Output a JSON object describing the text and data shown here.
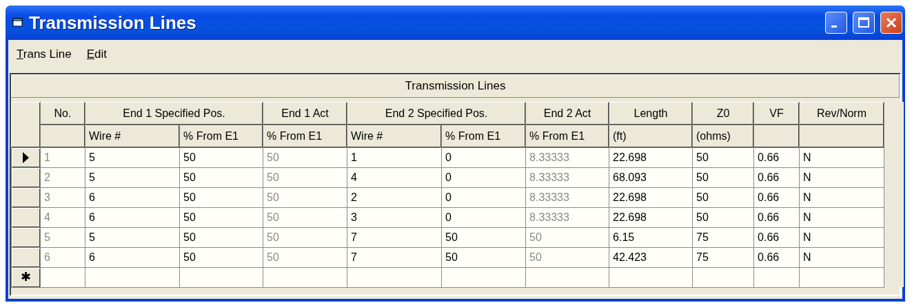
{
  "window": {
    "title": "Transmission Lines"
  },
  "menu": [
    "Trans Line",
    "Edit"
  ],
  "grid": {
    "caption": "Transmission Lines",
    "header_groups": [
      {
        "label": "No.",
        "columns": [
          {
            "readonly": true
          }
        ]
      },
      {
        "label": "End 1 Specified Pos.",
        "columns": [
          {
            "subheader": "Wire #",
            "readonly": false
          },
          {
            "subheader": "% From E1",
            "readonly": false
          }
        ]
      },
      {
        "label": "End 1 Act",
        "columns": [
          {
            "subheader": "% From E1",
            "readonly": true
          }
        ]
      },
      {
        "label": "End 2 Specified Pos.",
        "columns": [
          {
            "subheader": "Wire #",
            "readonly": false
          },
          {
            "subheader": "% From E1",
            "readonly": false
          }
        ]
      },
      {
        "label": "End 2 Act",
        "columns": [
          {
            "subheader": "% From E1",
            "readonly": true
          }
        ]
      },
      {
        "label": "Length",
        "columns": [
          {
            "subheader": "(ft)",
            "readonly": false
          }
        ]
      },
      {
        "label": "Z0",
        "columns": [
          {
            "subheader": "(ohms)",
            "readonly": false
          }
        ]
      },
      {
        "label": "VF",
        "columns": [
          {
            "readonly": false
          }
        ]
      },
      {
        "label": "Rev/Norm",
        "columns": [
          {
            "readonly": false
          }
        ]
      }
    ],
    "rows": [
      {
        "selected": true,
        "cells": [
          "1",
          "5",
          "50",
          "50",
          "1",
          "0",
          "8.33333",
          "22.698",
          "50",
          "0.66",
          "N"
        ]
      },
      {
        "selected": false,
        "cells": [
          "2",
          "5",
          "50",
          "50",
          "4",
          "0",
          "8.33333",
          "68.093",
          "50",
          "0.66",
          "N"
        ]
      },
      {
        "selected": false,
        "cells": [
          "3",
          "6",
          "50",
          "50",
          "2",
          "0",
          "8.33333",
          "22.698",
          "50",
          "0.66",
          "N"
        ]
      },
      {
        "selected": false,
        "cells": [
          "4",
          "6",
          "50",
          "50",
          "3",
          "0",
          "8.33333",
          "22.698",
          "50",
          "0.66",
          "N"
        ]
      },
      {
        "selected": false,
        "cells": [
          "5",
          "5",
          "50",
          "50",
          "7",
          "50",
          "50",
          "6.15",
          "75",
          "0.66",
          "N"
        ]
      },
      {
        "selected": false,
        "cells": [
          "6",
          "6",
          "50",
          "50",
          "7",
          "50",
          "50",
          "42.423",
          "75",
          "0.66",
          "N"
        ]
      }
    ],
    "new_row_marker": "✱"
  }
}
